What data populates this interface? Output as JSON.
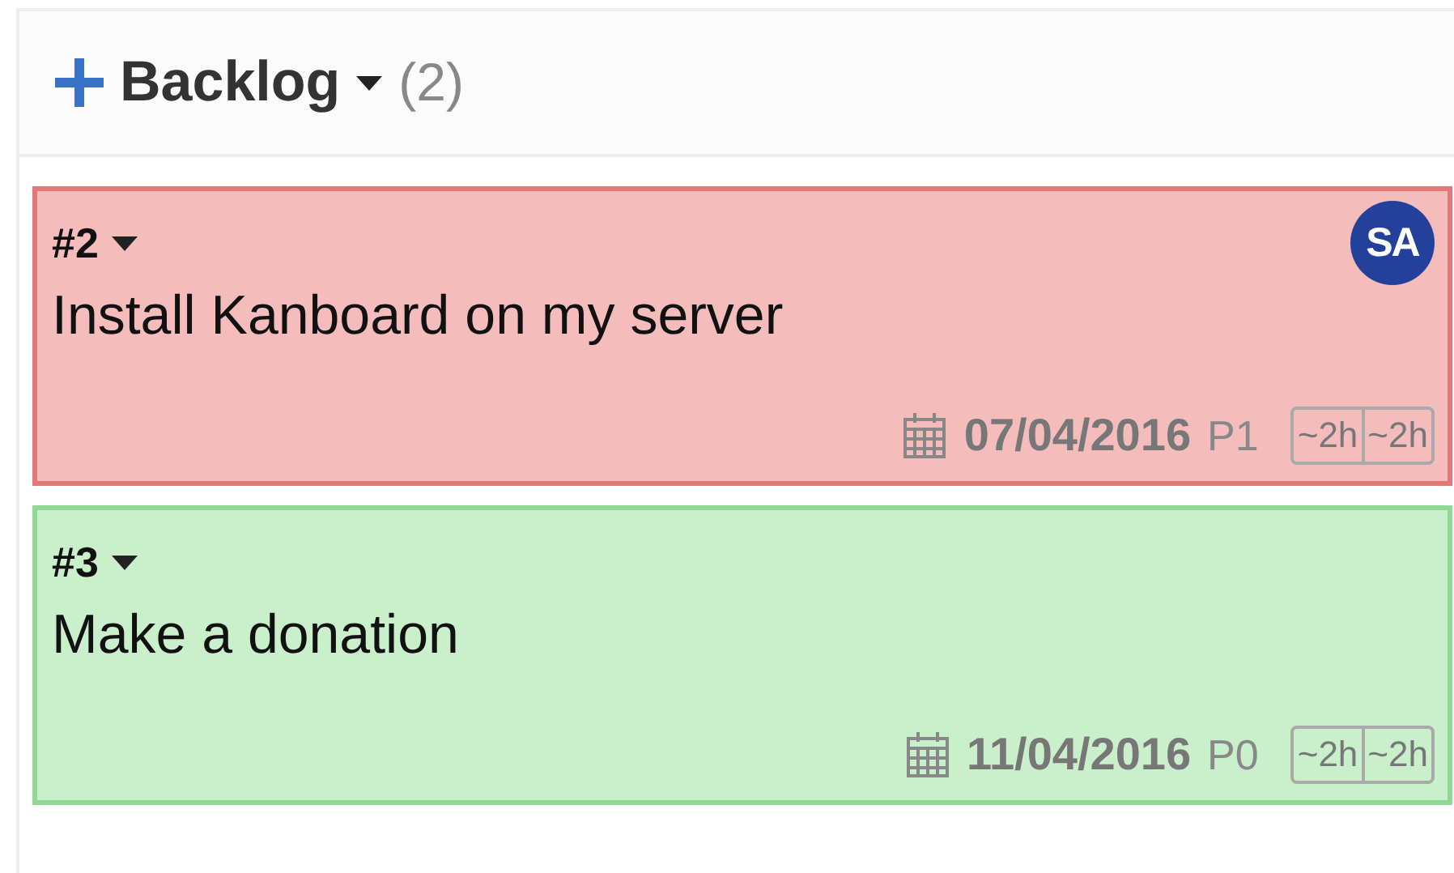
{
  "column": {
    "title": "Backlog",
    "count": "(2)"
  },
  "tasks": [
    {
      "id": "#2",
      "title": "Install Kanboard on my server",
      "assignee_initials": "SA",
      "date": "07/04/2016",
      "priority": "P1",
      "time_estimated": "~2h",
      "time_spent": "~2h",
      "color": "#f5bcbc"
    },
    {
      "id": "#3",
      "title": "Make a donation",
      "date": "11/04/2016",
      "priority": "P0",
      "time_estimated": "~2h",
      "time_spent": "~2h",
      "color": "#c9efcb"
    }
  ]
}
